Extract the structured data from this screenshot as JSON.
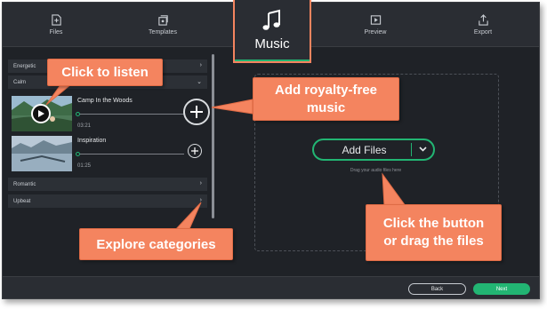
{
  "tabs": [
    {
      "id": "files",
      "label": "Files",
      "icon": "file-add-icon"
    },
    {
      "id": "templates",
      "label": "Templates",
      "icon": "templates-icon"
    },
    {
      "id": "music",
      "label": "Music",
      "icon": "music-note-icon",
      "active": true
    },
    {
      "id": "preview",
      "label": "Preview",
      "icon": "play-icon"
    },
    {
      "id": "export",
      "label": "Export",
      "icon": "export-icon"
    }
  ],
  "categories": {
    "energetic": "Energetic",
    "calm": "Calm",
    "romantic": "Romantic",
    "upbeat": "Upbeat"
  },
  "tracks": [
    {
      "title": "Camp In the Woods",
      "duration": "03:21",
      "progress": 0
    },
    {
      "title": "Inspiration",
      "duration": "01:25",
      "progress": 0
    }
  ],
  "add_files": {
    "label": "Add Files",
    "hint": "Drag your audio files here"
  },
  "bottom": {
    "back": "Back",
    "next": "Next"
  },
  "callouts": {
    "click_to_listen": "Click to listen",
    "add_music_line1": "Add royalty-free",
    "add_music_line2": "music",
    "explore": "Explore categories",
    "click_button_line1": "Click the button",
    "click_button_line2": "or drag the files"
  },
  "colors": {
    "accent": "#22b573",
    "callout": "#f4845f",
    "background": "#1f2227"
  }
}
